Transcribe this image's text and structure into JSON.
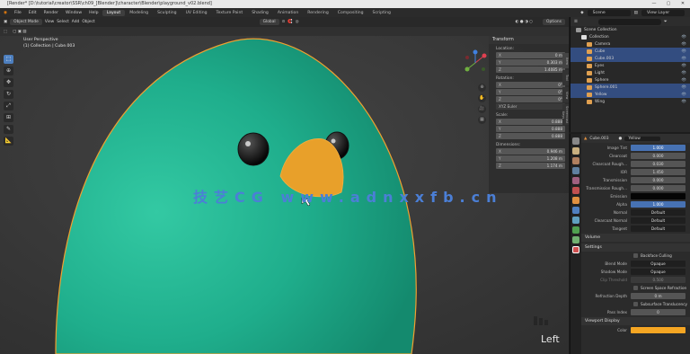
{
  "titlebar": {
    "title": "[Render* [D:\\tutorial\\creator\\SSR\\ch09_[Blender]\\character\\Blender\\playground_v02.blend]"
  },
  "menubar": {
    "menus": [
      "File",
      "Edit",
      "Render",
      "Window",
      "Help"
    ],
    "workspaces": [
      "Layout",
      "Modeling",
      "Sculpting",
      "UV Editing",
      "Texture Paint",
      "Shading",
      "Animation",
      "Rendering",
      "Compositing",
      "Scripting"
    ],
    "active_workspace": "Layout",
    "scene_label": "Scene",
    "view_layer_label": "View Layer"
  },
  "viewport_header": {
    "mode": "Object Mode",
    "menus": [
      "View",
      "Select",
      "Add",
      "Object"
    ],
    "transform_orientation": "Global",
    "options_label": "Options"
  },
  "viewport": {
    "perspective_label": "User Perspective",
    "collection_label": "(1) Collection | Cube.003",
    "view_name": "Left",
    "watermark": "技艺CG www.adnxxfb.cn"
  },
  "toolbar": {
    "icons": [
      "select-icon",
      "cursor-icon",
      "move-icon",
      "rotate-icon",
      "scale-icon",
      "transform-icon",
      "annotate-icon",
      "measure-icon"
    ]
  },
  "npanel": {
    "header": "Transform",
    "tabs": [
      "Item",
      "Tool",
      "View",
      "Screencast Keys"
    ],
    "location_label": "Location:",
    "location": [
      {
        "axis": "X",
        "value": "0 m"
      },
      {
        "axis": "Y",
        "value": "0.303 m"
      },
      {
        "axis": "Z",
        "value": "1.4085 m"
      }
    ],
    "rotation_label": "Rotation:",
    "rotation": [
      {
        "axis": "X",
        "value": "0°"
      },
      {
        "axis": "Y",
        "value": "0°"
      },
      {
        "axis": "Z",
        "value": "0°"
      }
    ],
    "rotation_mode": "XYZ Euler",
    "scale_label": "Scale:",
    "scale": [
      {
        "axis": "X",
        "value": "0.888"
      },
      {
        "axis": "Y",
        "value": "0.888"
      },
      {
        "axis": "Z",
        "value": "0.888"
      }
    ],
    "dimensions_label": "Dimensions:",
    "dimensions": [
      {
        "axis": "X",
        "value": "0.946 m"
      },
      {
        "axis": "Y",
        "value": "1.208 m"
      },
      {
        "axis": "Z",
        "value": "1.174 m"
      }
    ]
  },
  "outliner": {
    "root": "Scene Collection",
    "rows": [
      {
        "name": "Collection",
        "type": "col",
        "indent": 1,
        "selected": false
      },
      {
        "name": "Camera",
        "type": "obj",
        "indent": 2,
        "selected": false
      },
      {
        "name": "Cube",
        "type": "obj",
        "indent": 2,
        "selected": true
      },
      {
        "name": "Cube.003",
        "type": "obj",
        "indent": 2,
        "selected": true
      },
      {
        "name": "Eyes",
        "type": "obj",
        "indent": 2,
        "selected": false
      },
      {
        "name": "Light",
        "type": "obj",
        "indent": 2,
        "selected": false
      },
      {
        "name": "Sphere",
        "type": "obj",
        "indent": 2,
        "selected": false
      },
      {
        "name": "Sphere.001",
        "type": "obj",
        "indent": 2,
        "selected": true
      },
      {
        "name": "Yellow",
        "type": "obj",
        "indent": 2,
        "selected": true
      },
      {
        "name": "Wing",
        "type": "obj",
        "indent": 2,
        "selected": false
      }
    ]
  },
  "properties": {
    "object_name": "Cube.003",
    "material_name": "Yellow",
    "rows": [
      {
        "label": "Image Tint",
        "value": "1.000",
        "style": "blue"
      },
      {
        "label": "Clearcoat",
        "value": "0.000",
        "style": ""
      },
      {
        "label": "Clearcoat Rough...",
        "value": "0.030",
        "style": ""
      },
      {
        "label": "IOR",
        "value": "1.450",
        "style": ""
      },
      {
        "label": "Transmission",
        "value": "0.000",
        "style": ""
      },
      {
        "label": "Transmission Rough...",
        "value": "0.000",
        "style": ""
      },
      {
        "label": "Emission",
        "value": "",
        "style": "black"
      },
      {
        "label": "Alpha",
        "value": "1.000",
        "style": "blue"
      },
      {
        "label": "Normal",
        "value": "Default",
        "style": "dark"
      },
      {
        "label": "Clearcoat Normal",
        "value": "Default",
        "style": "dark"
      },
      {
        "label": "Tangent",
        "value": "Default",
        "style": "dark"
      }
    ],
    "section_volume": "Volume",
    "section_settings": "Settings",
    "backface_culling": "Backface Culling",
    "blend_mode_label": "Blend Mode",
    "blend_mode": "Opaque",
    "shadow_mode_label": "Shadow Mode",
    "shadow_mode": "Opaque",
    "clip_threshold_label": "Clip Threshold",
    "clip_threshold": "0.500",
    "screen_space_refraction": "Screen Space Refraction",
    "refraction_depth_label": "Refraction Depth",
    "refraction_depth": "0 m",
    "subsurface_translucency": "Subsurface Translucency",
    "pass_index_label": "Pass Index",
    "pass_index": "0",
    "section_viewport_display": "Viewport Display",
    "color_label": "Color"
  },
  "colors": {
    "body": "#22ad8c",
    "beak": "#e8a02a",
    "outline": "#f0a030",
    "accent": "#4772b3"
  }
}
